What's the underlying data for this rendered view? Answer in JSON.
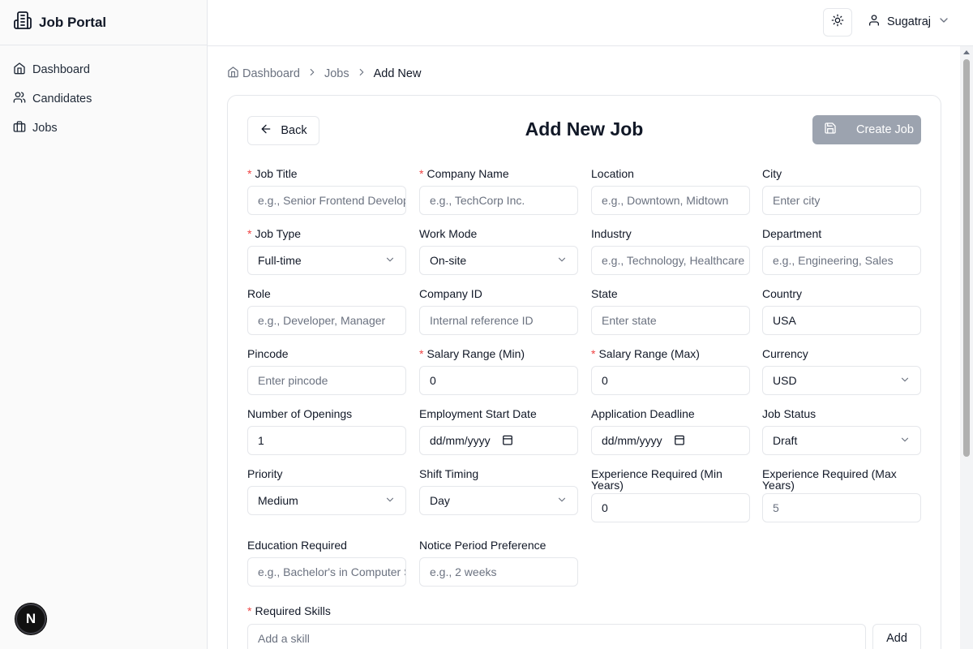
{
  "brand": {
    "title": "Job Portal",
    "icon": "building-icon"
  },
  "sidebar": {
    "items": [
      {
        "label": "Dashboard",
        "icon": "home-icon"
      },
      {
        "label": "Candidates",
        "icon": "users-icon"
      },
      {
        "label": "Jobs",
        "icon": "briefcase-icon"
      }
    ]
  },
  "header": {
    "user_name": "Sugatraj",
    "theme_icon": "sun-icon"
  },
  "breadcrumb": {
    "items": [
      "Dashboard",
      "Jobs",
      "Add New"
    ]
  },
  "form": {
    "title": "Add New Job",
    "back_label": "Back",
    "create_label": "Create Job",
    "fields": {
      "job_title": {
        "label": "Job Title",
        "required": true,
        "placeholder": "e.g., Senior Frontend Developer"
      },
      "company_name": {
        "label": "Company Name",
        "required": true,
        "placeholder": "e.g., TechCorp Inc."
      },
      "location": {
        "label": "Location",
        "placeholder": "e.g., Downtown, Midtown"
      },
      "city": {
        "label": "City",
        "placeholder": "Enter city"
      },
      "job_type": {
        "label": "Job Type",
        "required": true,
        "value": "Full-time"
      },
      "work_mode": {
        "label": "Work Mode",
        "value": "On-site"
      },
      "industry": {
        "label": "Industry",
        "placeholder": "e.g., Technology, Healthcare"
      },
      "department": {
        "label": "Department",
        "placeholder": "e.g., Engineering, Sales"
      },
      "role": {
        "label": "Role",
        "placeholder": "e.g., Developer, Manager"
      },
      "company_id": {
        "label": "Company ID",
        "placeholder": "Internal reference ID"
      },
      "state": {
        "label": "State",
        "placeholder": "Enter state"
      },
      "country": {
        "label": "Country",
        "value": "USA"
      },
      "pincode": {
        "label": "Pincode",
        "placeholder": "Enter pincode"
      },
      "salary_min": {
        "label": "Salary Range (Min)",
        "required": true,
        "value": "0"
      },
      "salary_max": {
        "label": "Salary Range (Max)",
        "required": true,
        "value": "0"
      },
      "currency": {
        "label": "Currency",
        "value": "USD"
      },
      "openings": {
        "label": "Number of Openings",
        "value": "1"
      },
      "start_date": {
        "label": "Employment Start Date",
        "placeholder": "dd/mm/yyyy"
      },
      "deadline": {
        "label": "Application Deadline",
        "placeholder": "dd/mm/yyyy"
      },
      "job_status": {
        "label": "Job Status",
        "value": "Draft"
      },
      "priority": {
        "label": "Priority",
        "value": "Medium"
      },
      "shift": {
        "label": "Shift Timing",
        "value": "Day"
      },
      "exp_min": {
        "label": "Experience Required (Min Years)",
        "value": "0"
      },
      "exp_max": {
        "label": "Experience Required (Max Years)",
        "placeholder": "5"
      },
      "education": {
        "label": "Education Required",
        "placeholder": "e.g., Bachelor's in Computer Science"
      },
      "notice": {
        "label": "Notice Period Preference",
        "placeholder": "e.g., 2 weeks"
      }
    },
    "skills": {
      "label": "Required Skills",
      "required": true,
      "placeholder": "Add a skill",
      "add_label": "Add"
    }
  },
  "next_badge": "N",
  "colors": {
    "required": "#ef4444",
    "create_button_bg": "#9ca3af",
    "border": "#e5e7eb"
  }
}
